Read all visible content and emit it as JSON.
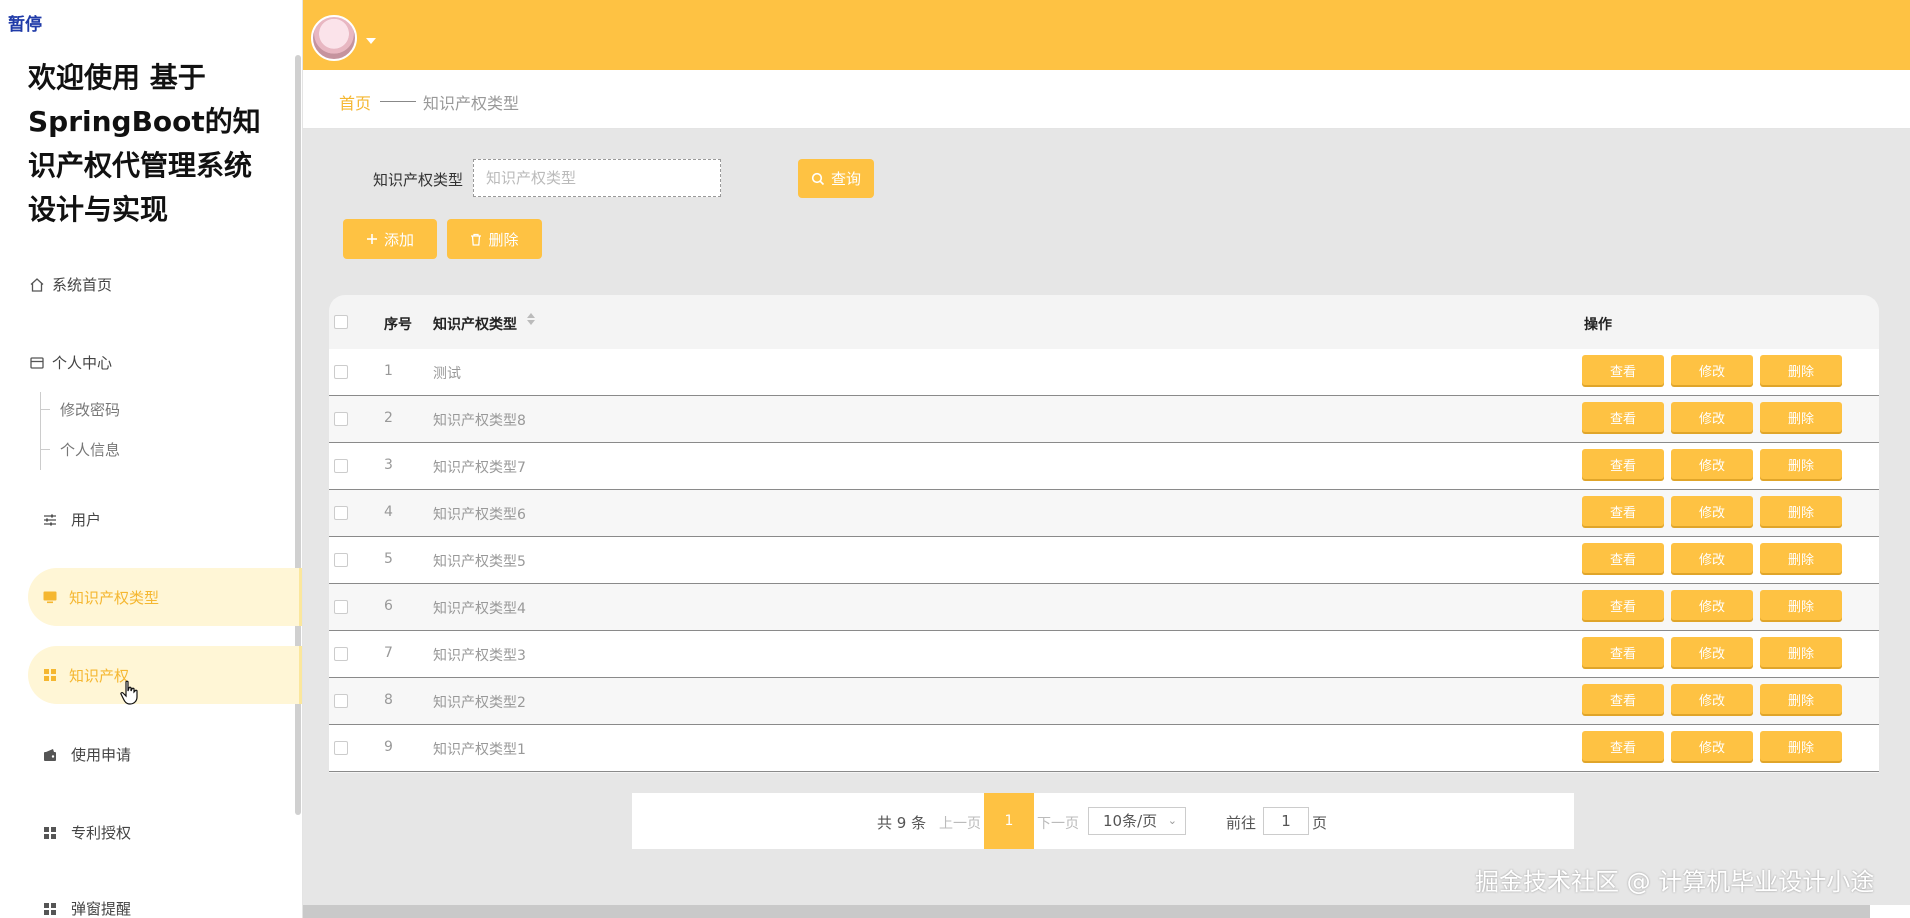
{
  "pause_tag": "暂停",
  "sidebar": {
    "title": "欢迎使用 基于SpringBoot的知识产权代管理系统设计与实现",
    "items": [
      {
        "label": "系统首页",
        "icon": "home-icon"
      },
      {
        "label": "个人中心",
        "icon": "card-icon"
      },
      {
        "label": "修改密码"
      },
      {
        "label": "个人信息"
      },
      {
        "label": "用户",
        "icon": "sliders-icon"
      },
      {
        "label": "知识产权类型",
        "icon": "monitor-icon",
        "active": true
      },
      {
        "label": "知识产权",
        "icon": "grid-icon",
        "hover": true
      },
      {
        "label": "使用申请",
        "icon": "wallet-icon"
      },
      {
        "label": "专利授权",
        "icon": "grid-icon"
      },
      {
        "label": "弹窗提醒",
        "icon": "grid-icon"
      }
    ]
  },
  "breadcrumb": {
    "home": "首页",
    "current": "知识产权类型"
  },
  "search": {
    "label": "知识产权类型",
    "placeholder": "知识产权类型",
    "value": "",
    "button": "查询"
  },
  "actions": {
    "add": "添加",
    "delete": "删除"
  },
  "table": {
    "headers": {
      "index": "序号",
      "type": "知识产权类型",
      "ops": "操作"
    },
    "rows": [
      {
        "index": "1",
        "type": "测试"
      },
      {
        "index": "2",
        "type": "知识产权类型8"
      },
      {
        "index": "3",
        "type": "知识产权类型7"
      },
      {
        "index": "4",
        "type": "知识产权类型6"
      },
      {
        "index": "5",
        "type": "知识产权类型5"
      },
      {
        "index": "6",
        "type": "知识产权类型4"
      },
      {
        "index": "7",
        "type": "知识产权类型3"
      },
      {
        "index": "8",
        "type": "知识产权类型2"
      },
      {
        "index": "9",
        "type": "知识产权类型1"
      }
    ],
    "ops": {
      "view": "查看",
      "edit": "修改",
      "delete": "删除"
    }
  },
  "pagination": {
    "total": "共 9 条",
    "prev": "上一页",
    "current": "1",
    "next": "下一页",
    "page_size": "10条/页",
    "goto_label": "前往",
    "goto_value": "1",
    "page_unit": "页"
  },
  "watermark": "掘金技术社区 @ 计算机毕业设计小途",
  "colors": {
    "accent": "#fec243",
    "active_bg": "#fff6d6",
    "active_text": "#f5b731"
  }
}
